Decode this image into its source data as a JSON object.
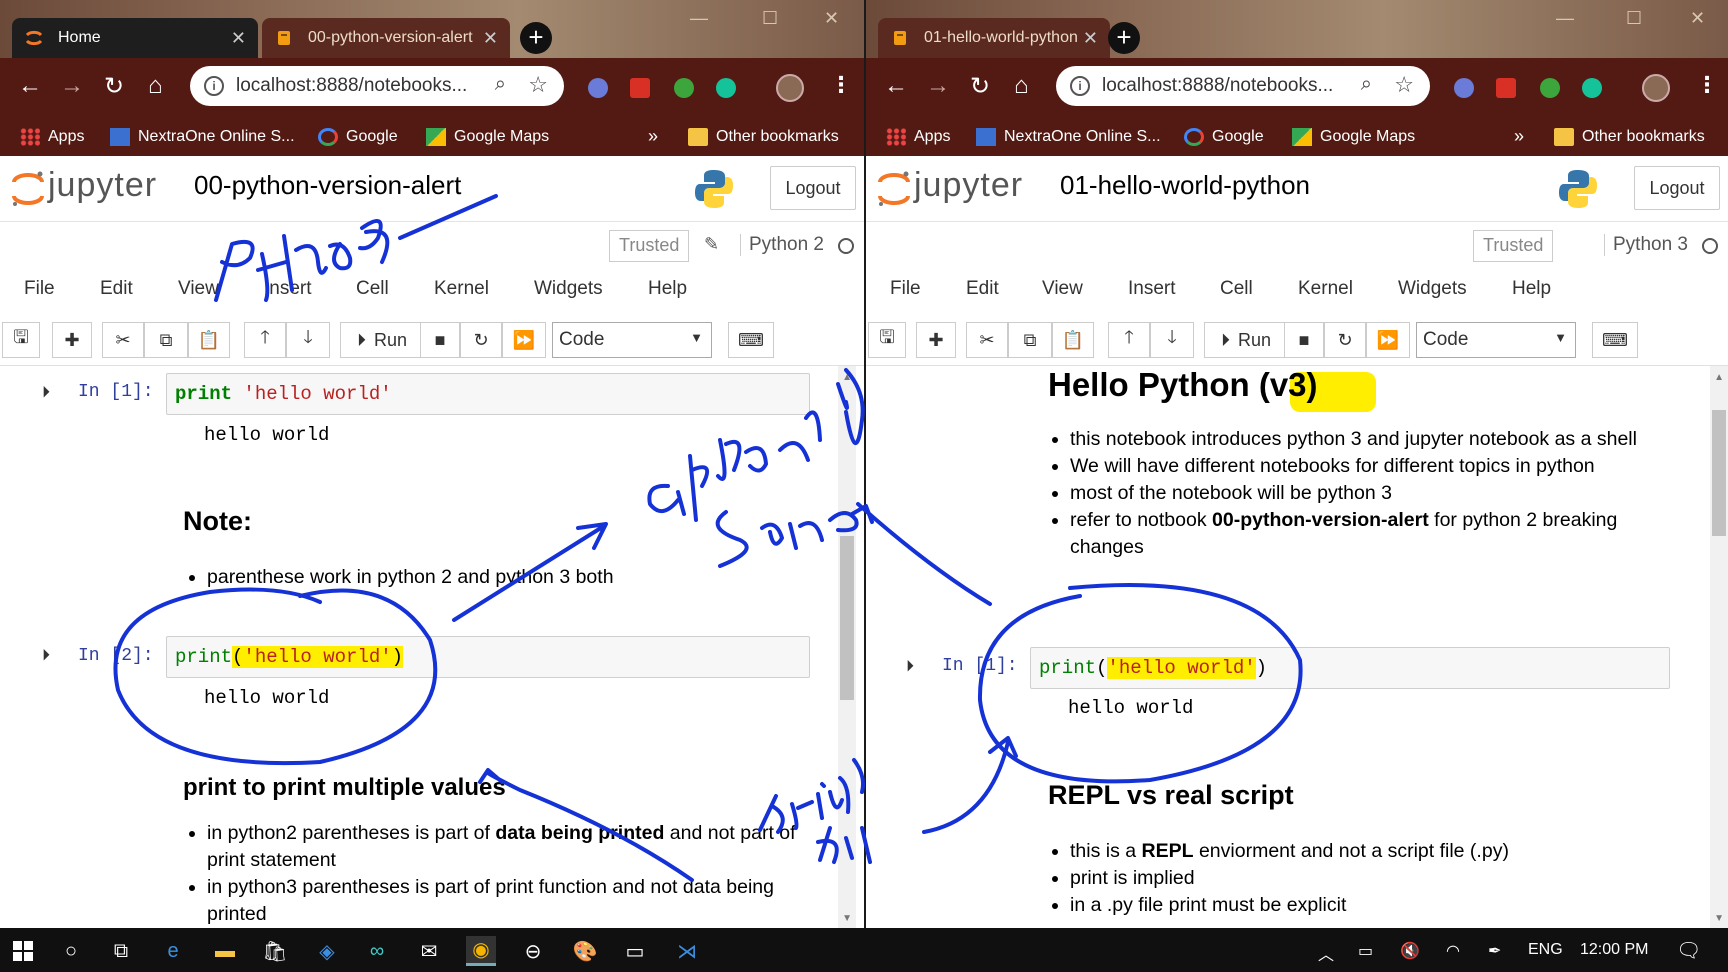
{
  "left": {
    "tabs": [
      {
        "title": "Home",
        "active": true
      },
      {
        "title": "00-python-version-alert",
        "active": false
      }
    ],
    "url": "localhost:8888/notebooks...",
    "bookmarks": [
      "Apps",
      "NextraOne Online S...",
      "Google",
      "Google Maps",
      "Other bookmarks"
    ],
    "notebook_title": "00-python-version-alert",
    "trusted": "Trusted",
    "kernel": "Python 2",
    "logout": "Logout",
    "menu": [
      "File",
      "Edit",
      "View",
      "Insert",
      "Cell",
      "Kernel",
      "Widgets",
      "Help"
    ],
    "run_label": "Run",
    "cell_type": "Code",
    "cell1_prompt": "In [1]:",
    "cell1_code_kw": "print",
    "cell1_code_str": "'hello world'",
    "cell1_output": "hello world",
    "note_heading": "Note:",
    "note_items": [
      "parenthese work in python 2 and python 3 both"
    ],
    "cell2_prompt": "In [2]:",
    "cell2_code_kw": "print",
    "cell2_code_open": "(",
    "cell2_code_str": "'hello world'",
    "cell2_code_close": ")",
    "cell2_output": "hello world",
    "multi_heading": "print to print multiple values",
    "multi_item1_a": "in python2 parentheses is part of ",
    "multi_item1_b": "data being printed",
    "multi_item1_c": " and not part of print statement",
    "multi_item2": "in python3 parentheses is part of print function and not data being printed"
  },
  "right": {
    "tabs": [
      {
        "title": "01-hello-world-python",
        "active": false
      }
    ],
    "url": "localhost:8888/notebooks...",
    "bookmarks": [
      "Apps",
      "NextraOne Online S...",
      "Google",
      "Google Maps",
      "Other bookmarks"
    ],
    "notebook_title": "01-hello-world-python",
    "trusted": "Trusted",
    "kernel": "Python 3",
    "logout": "Logout",
    "menu": [
      "File",
      "Edit",
      "View",
      "Insert",
      "Cell",
      "Kernel",
      "Widgets",
      "Help"
    ],
    "run_label": "Run",
    "cell_type": "Code",
    "heading_a": "Hello Python ",
    "heading_b": "(v3)",
    "intro_items": [
      "this notebook introduces python 3 and jupyter notebook as a shell",
      "We will have different notebooks for different topics in python",
      "most of the notebook will be python 3"
    ],
    "intro_item4_a": "refer to notbook ",
    "intro_item4_b": "00-python-version-alert",
    "intro_item4_c": " for python 2 breaking changes",
    "cell1_prompt": "In [1]:",
    "cell1_code_kw": "print",
    "cell1_code_open": "(",
    "cell1_code_str": "'hello world'",
    "cell1_code_close": ")",
    "cell1_output": "hello world",
    "repl_heading": "REPL vs real script",
    "repl_item1_a": "this is a ",
    "repl_item1_b": "REPL",
    "repl_item1_c": " enviorment and not a script file (.py)",
    "repl_items": [
      "print is implied",
      "in a .py file print must be explicit"
    ]
  },
  "taskbar": {
    "lang": "ENG",
    "time": "12:00 PM"
  },
  "colors": {
    "chrome_toolbar": "#531a14",
    "ink": "#1532d6",
    "highlight": "#ffee00",
    "prompt": "#303f9f",
    "keyword": "#008000",
    "string": "#ba2121"
  },
  "icons": [
    "search-icon",
    "star-icon",
    "back-icon",
    "forward-icon",
    "reload-icon",
    "home-icon",
    "python-logo-icon",
    "save-icon",
    "plus-icon",
    "cut-icon",
    "copy-icon",
    "paste-icon",
    "arrow-up-icon",
    "arrow-down-icon",
    "stop-icon",
    "restart-icon",
    "fast-forward-icon",
    "keyboard-icon"
  ]
}
